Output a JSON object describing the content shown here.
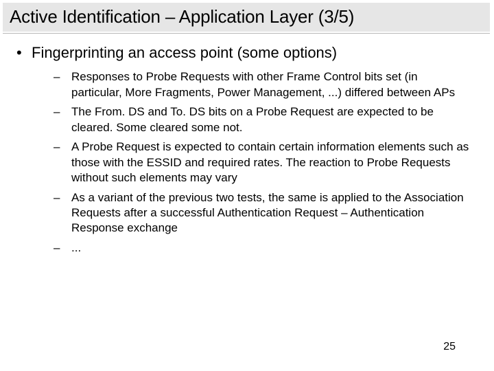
{
  "title": "Active Identification – Application Layer (3/5)",
  "bullet_symbol": "•",
  "dash_symbol": "–",
  "level1_text": "Fingerprinting an access point (some options)",
  "items": [
    "Responses to Probe Requests with other Frame Control bits set (in particular, More Fragments, Power Management, ...) differed between APs",
    "The From. DS and To. DS bits on a Probe Request are expected to be cleared. Some cleared some not.",
    "A Probe Request is expected to contain certain information elements such as those with the ESSID and required rates. The reaction to Probe Requests without such elements may vary",
    "As a variant of the previous two tests, the same is applied to the Association Requests after a successful Authentication Request – Authentication Response exchange",
    "..."
  ],
  "page_number": "25"
}
